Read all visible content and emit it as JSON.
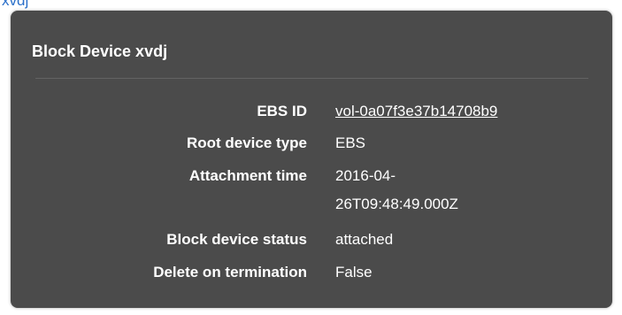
{
  "top_link": "xvdj",
  "panel": {
    "title": "Block Device xvdj",
    "rows": [
      {
        "label": "EBS ID",
        "value": "vol-0a07f3e37b14708b9"
      },
      {
        "label": "Root device type",
        "value": "EBS"
      },
      {
        "label": "Attachment time",
        "value": "2016-04-26T09:48:49.000Z"
      },
      {
        "label": "Block device status",
        "value": "attached"
      },
      {
        "label": "Delete on termination",
        "value": "False"
      }
    ]
  },
  "colors": {
    "panel_bg": "#4b4b4b",
    "link_blue": "#2a6fc9",
    "text": "#ffffff"
  }
}
